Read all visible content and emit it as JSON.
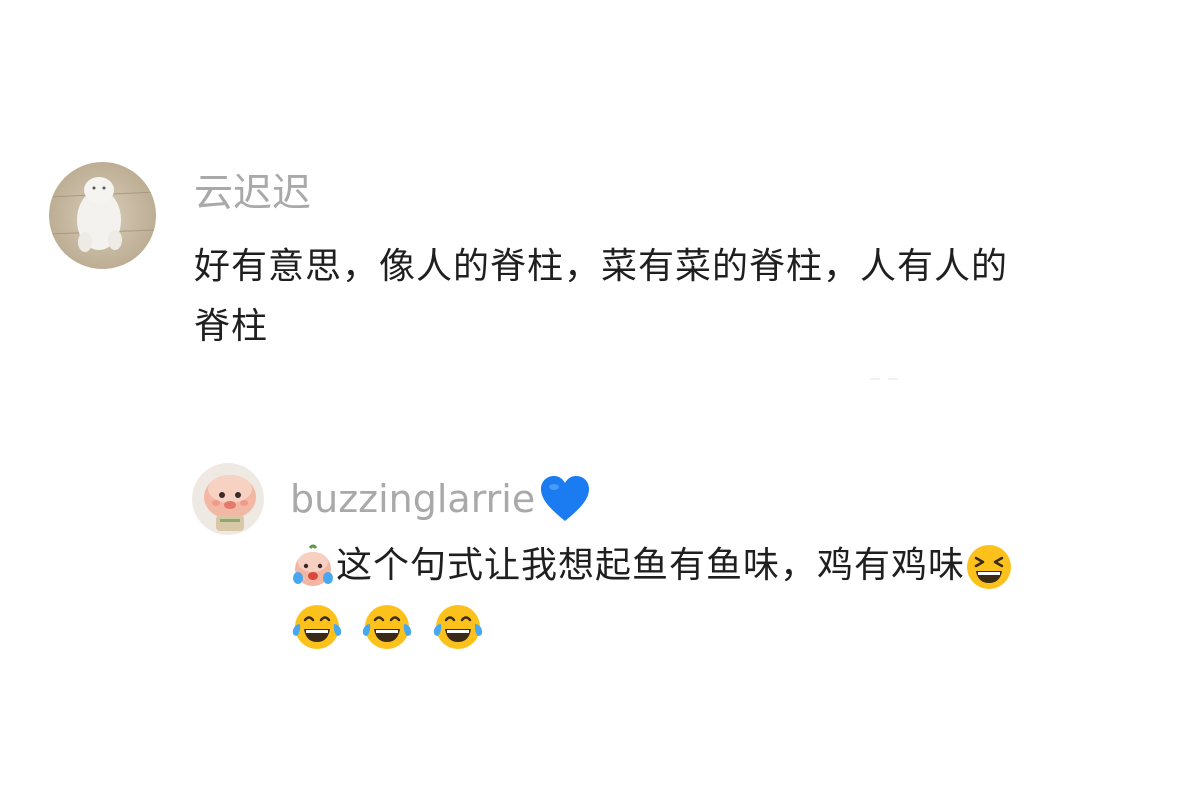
{
  "comments": [
    {
      "username": "云迟迟",
      "text_line1": "好有意思，像人的脊柱，菜有菜的脊柱，人有人的",
      "text_line2": "脊柱",
      "avatar": "puppy-avatar"
    },
    {
      "username": "buzzinglarrie",
      "username_badge": "blue-heart-icon",
      "text_line1": "这个句式让我想起鱼有鱼味，鸡有鸡味",
      "lead_emoji": "crying-doll-emoji",
      "trail_emoji": "grinning-squint-emoji",
      "line2_emojis": [
        "tears-of-joy-emoji",
        "tears-of-joy-emoji",
        "tears-of-joy-emoji"
      ],
      "avatar": "doll-avatar"
    }
  ],
  "colors": {
    "username": "#a9a9a9",
    "text": "#1f1f1f",
    "heart": "#1a7cf0"
  }
}
